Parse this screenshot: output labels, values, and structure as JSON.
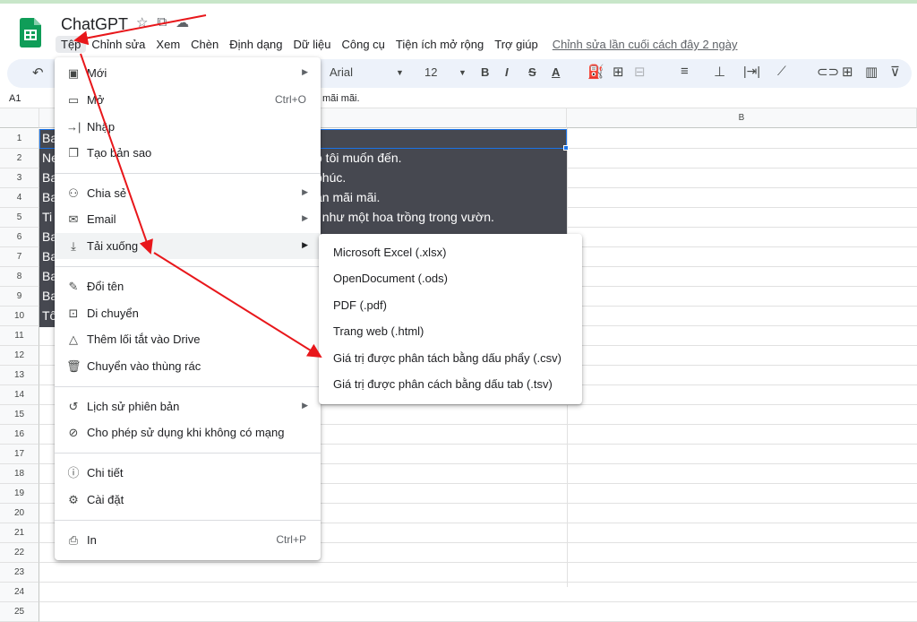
{
  "app": {
    "title": "ChatGPT",
    "icons": [
      "star-icon",
      "move-to-folder-icon",
      "cloud-status-icon"
    ]
  },
  "menubar": {
    "items": [
      "Tệp",
      "Chỉnh sửa",
      "Xem",
      "Chèn",
      "Định dạng",
      "Dữ liệu",
      "Công cụ",
      "Tiện ích mở rộng",
      "Trợ giúp"
    ],
    "last_edit": "Chỉnh sửa lần cuối cách đây 2 ngày"
  },
  "toolbar": {
    "font": "Arial",
    "font_size": "12",
    "bold": "B",
    "italic": "I",
    "strike": "S",
    "text_color": "A"
  },
  "formula_bar": {
    "cell_ref": "A1",
    "content_visible": "mãi mãi."
  },
  "grid": {
    "col_b": "B",
    "rows": [
      "1",
      "2",
      "3",
      "4",
      "5",
      "6",
      "7",
      "8",
      "9",
      "10",
      "11",
      "12",
      "13",
      "14",
      "15",
      "16",
      "17",
      "18",
      "19",
      "20",
      "21",
      "22",
      "23",
      "24",
      "25"
    ],
    "left_fragments": [
      "Ba",
      "Ne",
      "Ba",
      "Ba",
      "Ti",
      "Ba",
      "Ba",
      "Ba",
      "Ba",
      "Tô"
    ],
    "cell_fragments": [
      "ỗ tôi muốn đến.",
      "phúc.",
      "ạn mãi mãi.",
      ", như một hoa trồng trong vườn."
    ]
  },
  "file_menu": {
    "items": [
      {
        "label": "Mới",
        "shortcut": "",
        "icon": "new-icon"
      },
      {
        "label": "Mở",
        "shortcut": "Ctrl+O",
        "icon": "folder-icon"
      },
      {
        "label": "Nhập",
        "shortcut": "",
        "icon": "import-icon"
      },
      {
        "label": "Tạo bản sao",
        "shortcut": "",
        "icon": "copy-icon"
      },
      {
        "label": "Chia sẻ",
        "shortcut": "",
        "icon": "share-icon"
      },
      {
        "label": "Email",
        "shortcut": "",
        "icon": "email-icon"
      },
      {
        "label": "Tải xuống",
        "shortcut": "",
        "icon": "download-icon"
      },
      {
        "label": "Đổi tên",
        "shortcut": "",
        "icon": "rename-icon"
      },
      {
        "label": "Di chuyển",
        "shortcut": "",
        "icon": "move-icon"
      },
      {
        "label": "Thêm lối tắt vào Drive",
        "shortcut": "",
        "icon": "shortcut-icon"
      },
      {
        "label": "Chuyển vào thùng rác",
        "shortcut": "",
        "icon": "trash-icon"
      },
      {
        "label": "Lịch sử phiên bản",
        "shortcut": "",
        "icon": "history-icon"
      },
      {
        "label": "Cho phép sử dụng khi không có mạng",
        "shortcut": "",
        "icon": "offline-icon"
      },
      {
        "label": "Chi tiết",
        "shortcut": "",
        "icon": "info-icon"
      },
      {
        "label": "Cài đặt",
        "shortcut": "",
        "icon": "settings-icon"
      },
      {
        "label": "In",
        "shortcut": "Ctrl+P",
        "icon": "print-icon"
      }
    ]
  },
  "download_submenu": {
    "items": [
      "Microsoft Excel (.xlsx)",
      "OpenDocument (.ods)",
      "PDF (.pdf)",
      "Trang web (.html)",
      "Giá trị được phân tách bằng dấu phẩy (.csv)",
      "Giá trị được phân cách bằng dấu tab (.tsv)"
    ]
  },
  "colors": {
    "annotation_arrow": "#e8171b",
    "selection_fill": "#464850",
    "accent": "#1a73e8",
    "sheets_green": "#0f9d58"
  }
}
